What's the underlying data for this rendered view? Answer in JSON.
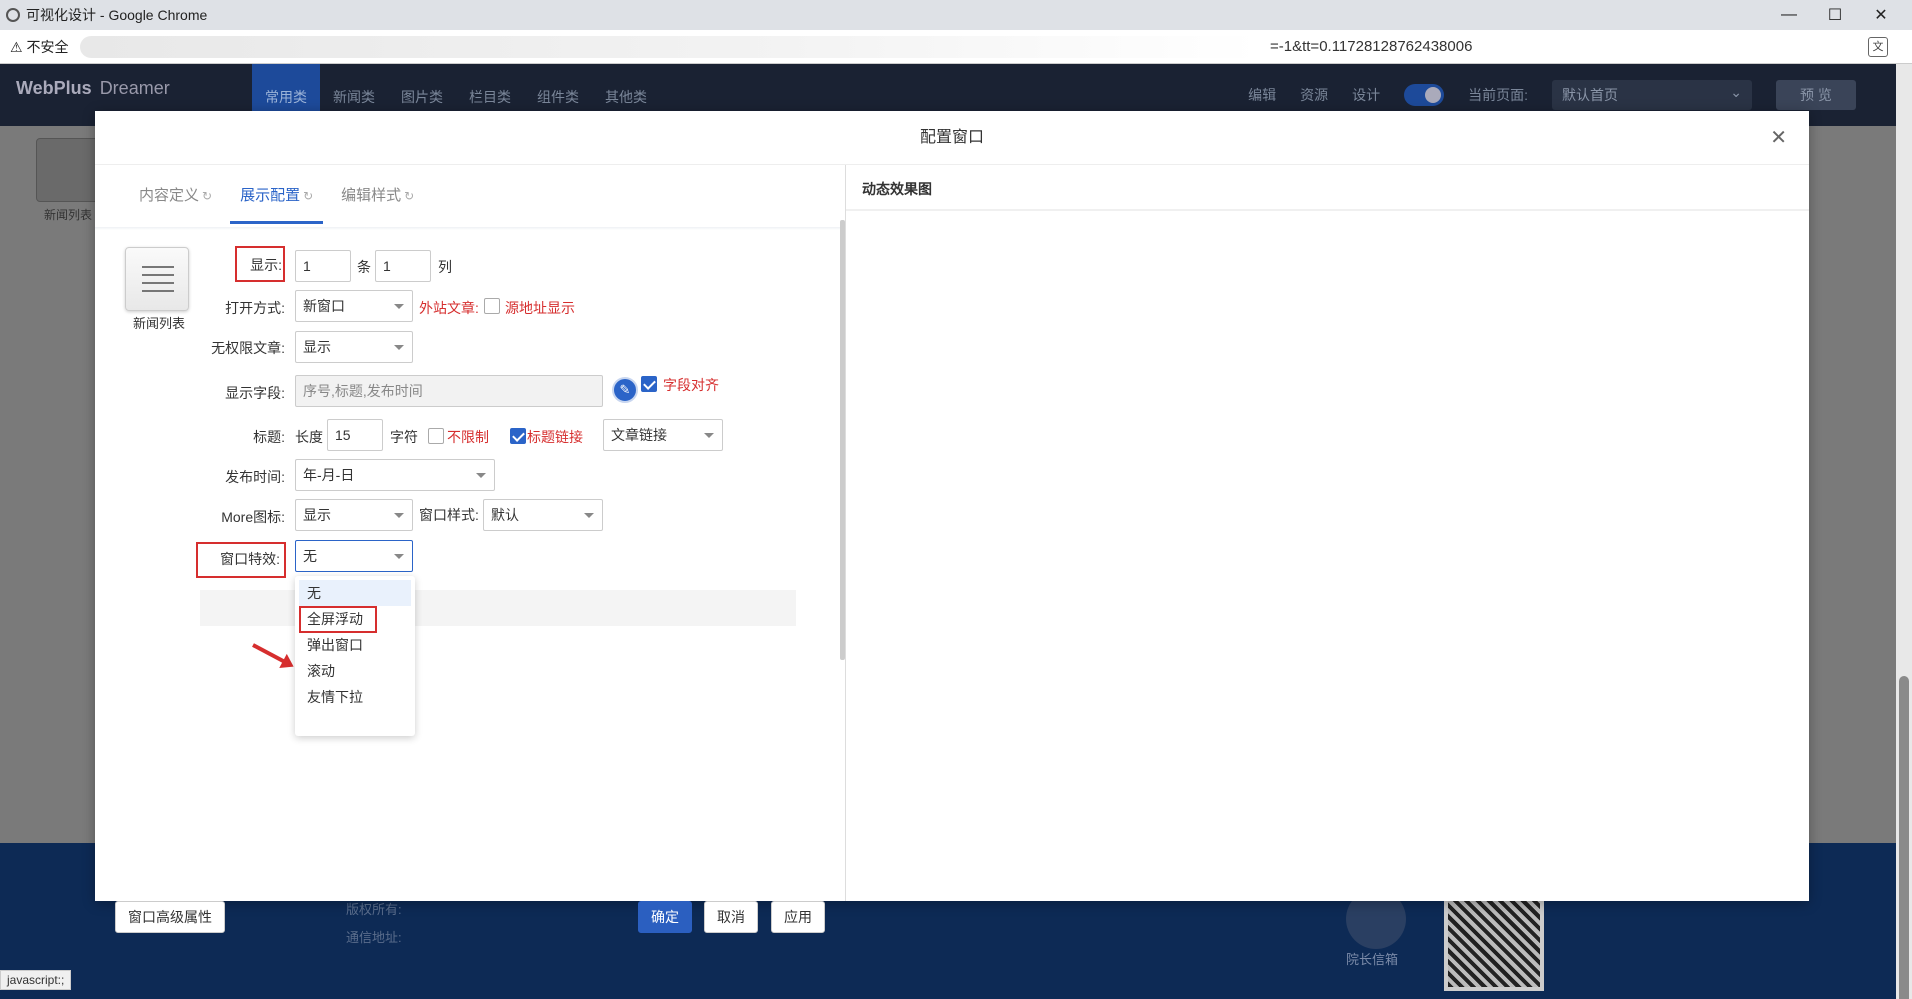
{
  "browser": {
    "window_title": "可视化设计 - Google Chrome",
    "security_label": "不安全",
    "url_visible": "=-1&tt=0.11728128762438006"
  },
  "app": {
    "logo": "WebPlus",
    "logo_sub": "Dreamer",
    "nav_tabs": [
      "常用类",
      "新闻类",
      "图片类",
      "栏目类",
      "组件类",
      "其他类"
    ],
    "header_right": {
      "edit": "编辑",
      "resource": "资源",
      "design": "设计",
      "current_page_label": "当前页面:",
      "current_page_value": "默认首页",
      "preview": "预 览"
    },
    "bg_widget_label": "新闻列表",
    "footer": {
      "copyright": "版权所有:",
      "address": "通信地址:",
      "mailbox": "院长信箱"
    },
    "status": "javascript:;"
  },
  "modal": {
    "title": "配置窗口",
    "tabs": [
      "内容定义",
      "展示配置",
      "编辑样式"
    ],
    "widget_label": "新闻列表",
    "form": {
      "display_label": "显示:",
      "display_rows": "1",
      "rows_unit": "条",
      "display_cols": "1",
      "cols_unit": "列",
      "open_label": "打开方式:",
      "open_value": "新窗口",
      "external_label": "外站文章:",
      "source_label": "源地址显示",
      "noperm_label": "无权限文章:",
      "noperm_value": "显示",
      "fields_label": "显示字段:",
      "fields_value": "序号,标题,发布时间",
      "align_label": "字段对齐",
      "title_label": "标题:",
      "length_label": "长度",
      "length_value": "15",
      "chars_unit": "字符",
      "unlimited_label": "不限制",
      "title_link_label": "标题链接",
      "link_type": "文章链接",
      "pubtime_label": "发布时间:",
      "pubtime_value": "年-月-日",
      "more_label": "More图标:",
      "more_value": "显示",
      "window_style_label": "窗口样式:",
      "window_style_value": "默认",
      "effect_label": "窗口特效:",
      "effect_value": "无"
    },
    "effect_options": [
      "无",
      "全屏浮动",
      "弹出窗口",
      "滚动",
      "友情下拉"
    ],
    "buttons": {
      "advanced": "窗口高级属性",
      "ok": "确定",
      "cancel": "取消",
      "apply": "应用"
    },
    "preview_title": "动态效果图"
  }
}
